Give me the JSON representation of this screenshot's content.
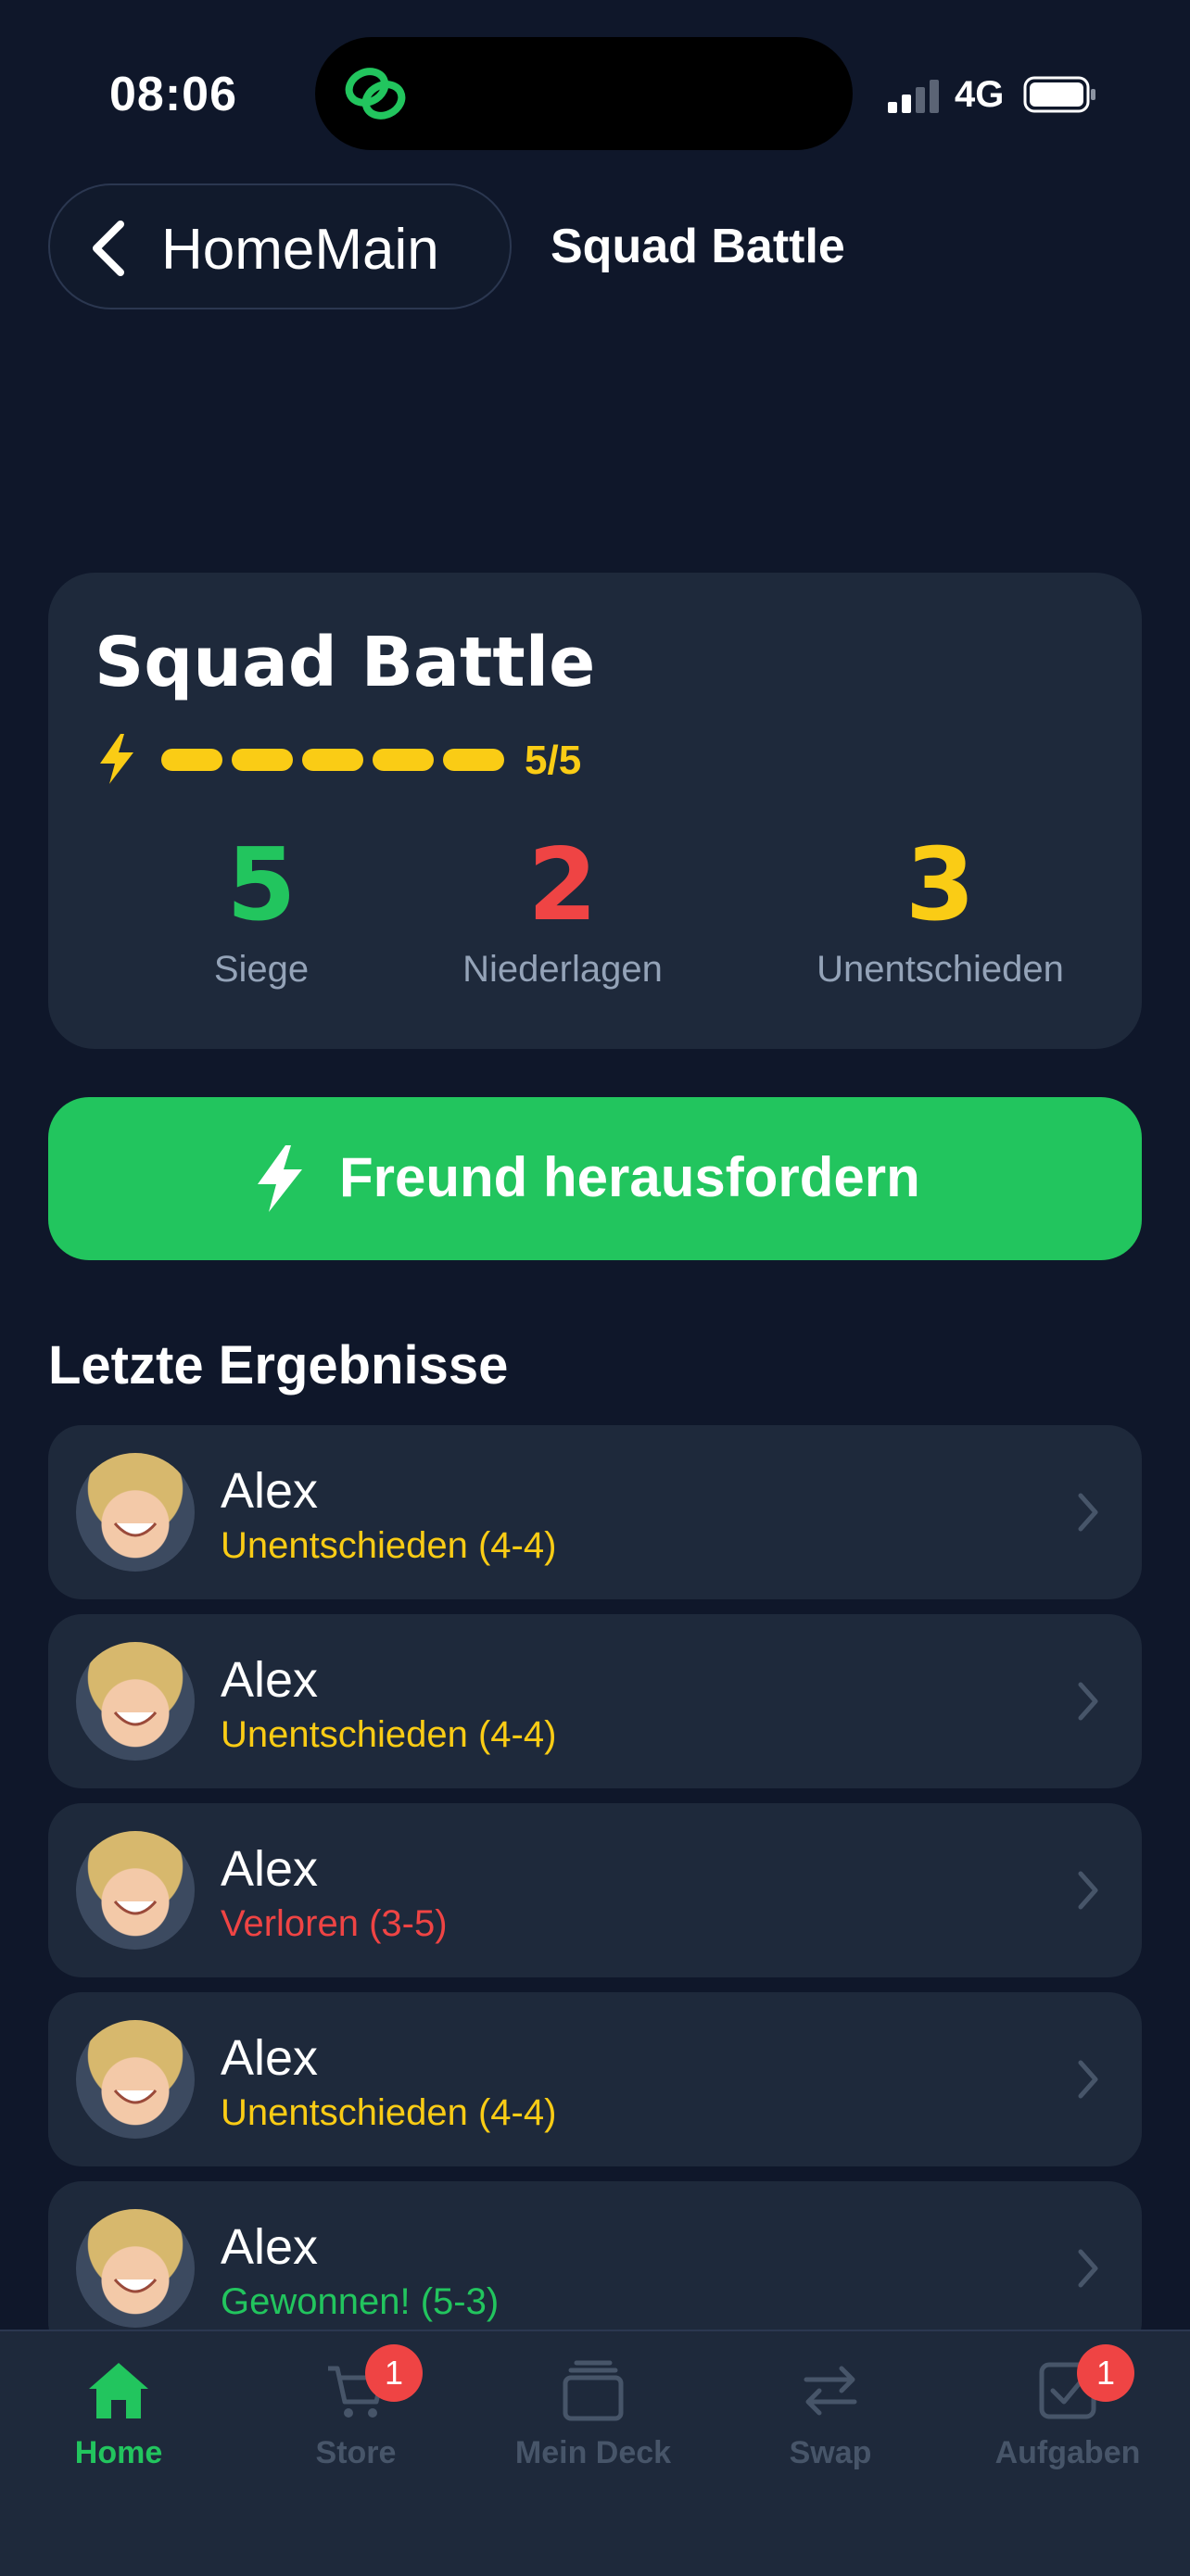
{
  "status_bar": {
    "time": "08:06",
    "network": "4G"
  },
  "nav": {
    "back_label": "HomeMain",
    "title": "Squad Battle"
  },
  "battle": {
    "title": "Squad Battle",
    "energy": {
      "current": 5,
      "max": 5,
      "label": "5/5"
    },
    "stats": [
      {
        "value": "5",
        "label": "Siege",
        "color": "#22c55e"
      },
      {
        "value": "2",
        "label": "Niederlagen",
        "color": "#ef4444"
      },
      {
        "value": "3",
        "label": "Unentschieden",
        "color": "#facc15"
      }
    ]
  },
  "challenge_button": {
    "label": "Freund herausfordern"
  },
  "results": {
    "title": "Letzte Ergebnisse",
    "items": [
      {
        "name": "Alex",
        "status": "Unentschieden (4-4)",
        "color": "#facc15"
      },
      {
        "name": "Alex",
        "status": "Unentschieden (4-4)",
        "color": "#facc15"
      },
      {
        "name": "Alex",
        "status": "Verloren (3-5)",
        "color": "#ef4444"
      },
      {
        "name": "Alex",
        "status": "Unentschieden (4-4)",
        "color": "#facc15"
      },
      {
        "name": "Alex",
        "status": "Gewonnen! (5-3)",
        "color": "#22c55e"
      }
    ]
  },
  "tabs": [
    {
      "label": "Home",
      "icon": "home-icon",
      "active": true
    },
    {
      "label": "Store",
      "icon": "cart-icon",
      "badge": "1"
    },
    {
      "label": "Mein Deck",
      "icon": "cards-icon"
    },
    {
      "label": "Swap",
      "icon": "swap-icon"
    },
    {
      "label": "Aufgaben",
      "icon": "tasks-icon",
      "badge": "1"
    }
  ],
  "colors": {
    "background": "#0f172a",
    "card": "#1e293b",
    "accent": "#22c55e"
  }
}
